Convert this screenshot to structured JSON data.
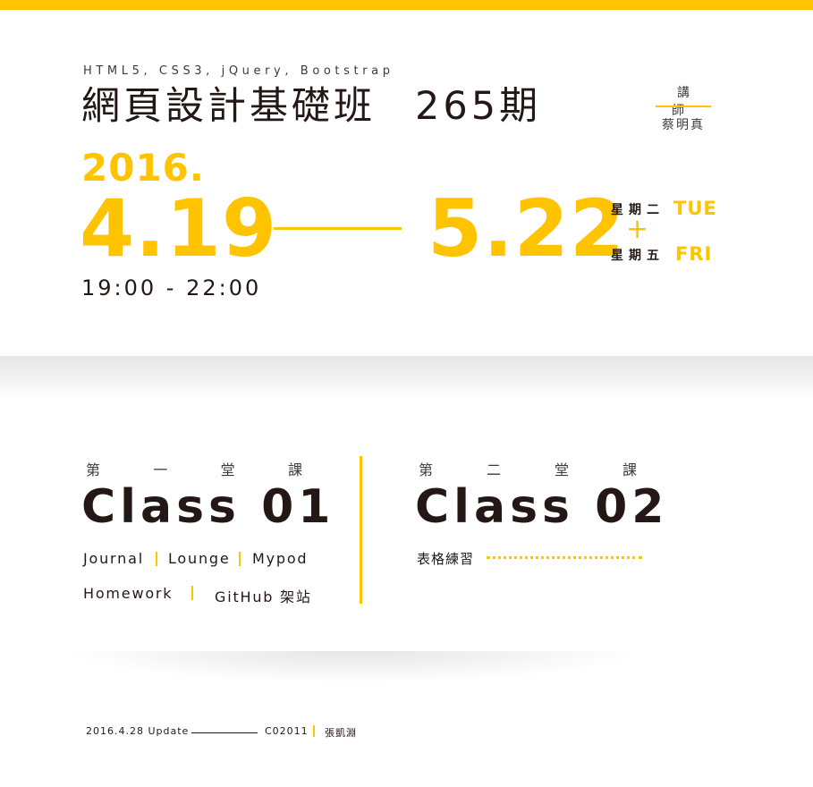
{
  "header": {
    "subtitle": "HTML5, CSS3, jQuery, Bootstrap",
    "title": "網頁設計基礎班",
    "session": "265期",
    "instructor_label": "講師",
    "instructor_name": "蔡明真"
  },
  "schedule": {
    "year": "2016.",
    "start_date": "4.19",
    "end_date": "5.22",
    "time": "19:00 - 22:00",
    "day1_cn": "星期二",
    "day1_en": "TUE",
    "plus": "+",
    "day2_cn": "星期五",
    "day2_en": "FRI"
  },
  "class1": {
    "label_chars": [
      "第",
      "一",
      "堂",
      "課"
    ],
    "title": "Class 01",
    "topics": [
      "Journal",
      "Lounge",
      "Mypod",
      "Homework",
      "GitHub 架站"
    ]
  },
  "class2": {
    "label_chars": [
      "第",
      "二",
      "堂",
      "課"
    ],
    "title": "Class 02",
    "topics": [
      "表格練習"
    ]
  },
  "footer": {
    "update": "2016.4.28 Update",
    "code": "C02011",
    "author": "張凱淵"
  },
  "colors": {
    "accent": "#ffc300",
    "text": "#231815",
    "background": "#ffffff"
  }
}
